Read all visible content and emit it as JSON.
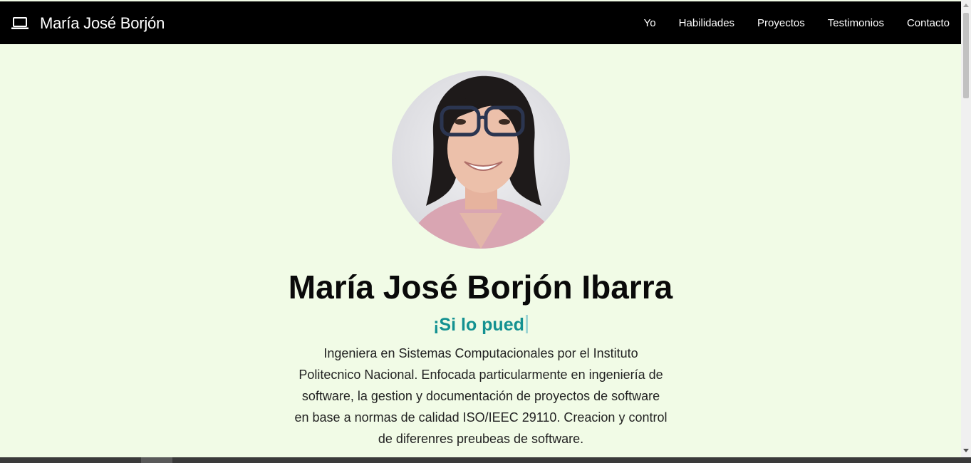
{
  "navbar": {
    "brand_icon": "laptop-icon",
    "brand_name": "María José Borjón",
    "links": [
      "Yo",
      "Habilidades",
      "Proyectos",
      "Testimonios",
      "Contacto"
    ]
  },
  "hero": {
    "name": "María José Borjón Ibarra",
    "typed_text": "¡Si lo pued",
    "bio_lines": [
      "Ingeniera en Sistemas Computacionales por el Instituto",
      "Politecnico Nacional. Enfocada particularmente en ingeniería de",
      "software, la gestion y documentación de proyectos de software",
      "en base a normas de calidad ISO/IEEC 29110. Creacion y control",
      "de diferenres preubeas de software."
    ]
  },
  "colors": {
    "navbar_bg": "#000000",
    "page_bg": "#f1fbe6",
    "accent": "#139191"
  }
}
